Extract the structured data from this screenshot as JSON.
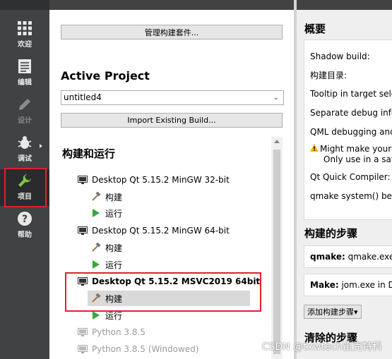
{
  "sidebar": {
    "items": [
      {
        "label": "欢迎",
        "icon": "grid-icon"
      },
      {
        "label": "编辑",
        "icon": "document-icon"
      },
      {
        "label": "设计",
        "icon": "pencil-icon"
      },
      {
        "label": "调试",
        "icon": "bug-icon"
      },
      {
        "label": "项目",
        "icon": "wrench-icon"
      },
      {
        "label": "帮助",
        "icon": "help-icon"
      }
    ]
  },
  "middle": {
    "manage_kits_button": "管理构建套件...",
    "active_project_heading": "Active Project",
    "project_combo_value": "untitled4",
    "import_build_button": "Import Existing Build...",
    "build_run_heading": "构建和运行",
    "tree": {
      "kit1": "Desktop Qt 5.15.2 MinGW 32-bit",
      "kit1_build": "构建",
      "kit1_run": "运行",
      "kit2": "Desktop Qt 5.15.2 MinGW 64-bit",
      "kit2_build": "构建",
      "kit2_run": "运行",
      "kit3": "Desktop Qt 5.15.2 MSVC2019 64bit",
      "kit3_build": "构建",
      "kit3_run": "运行",
      "kit4": "Python 3.8.5",
      "kit5": "Python 3.8.5 (Windowed)"
    }
  },
  "right": {
    "overview_heading": "概要",
    "lines": [
      "Shadow build:",
      "构建目录:",
      "Tooltip in target sele",
      "Separate debug info",
      "QML debugging and",
      "Might make your",
      "Only use in a safe",
      "Qt Quick Compiler:",
      "qmake system() beh"
    ],
    "build_steps_heading": "构建的步骤",
    "qmake_step_label": "qmake:",
    "qmake_step_value": "qmake.exe",
    "make_step_label": "Make:",
    "make_step_value": "jom.exe in D:",
    "add_build_step_button": "添加构建步骤▾",
    "clean_steps_heading": "清除的步骤"
  },
  "watermark": "CSDN @txwtech笛克特科",
  "colors": {
    "sidebar_bg": "#404244",
    "highlight_red": "#e0202e",
    "run_green": "#3aa53a",
    "hammer_brown": "#b0703a"
  }
}
